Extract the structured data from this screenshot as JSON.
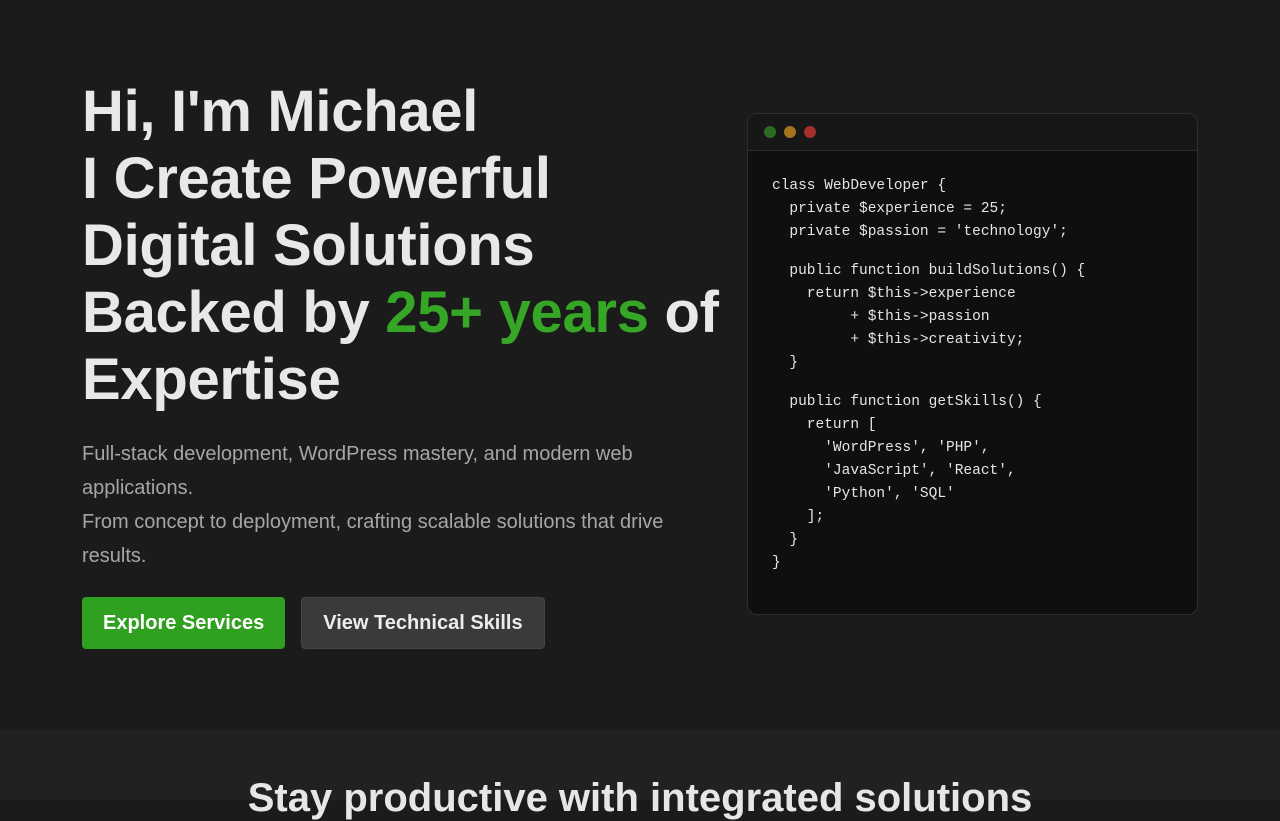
{
  "hero": {
    "line1": "Hi, I'm Michael",
    "line2": "I Create Powerful",
    "line3": "Digital Solutions",
    "line4_pre": "Backed by ",
    "line4_accent": "25+ years",
    "line4_post": " of",
    "line5": "Expertise",
    "accent_color": "#35a626",
    "sub1": "Full-stack development, WordPress mastery, and modern web applications.",
    "sub2": "From concept to deployment, crafting scalable solutions that drive results.",
    "primary_cta": "Explore Services",
    "secondary_cta": "View Technical Skills"
  },
  "code_window": {
    "dots": [
      "green",
      "yellow",
      "red"
    ],
    "lines": [
      "class WebDeveloper {",
      "  private $experience = 25;",
      "  private $passion = 'technology';",
      "",
      "  public function buildSolutions() {",
      "    return $this->experience",
      "         + $this->passion",
      "         + $this->creativity;",
      "  }",
      "",
      "  public function getSkills() {",
      "    return [",
      "      'WordPress', 'PHP',",
      "      'JavaScript', 'React',",
      "      'Python', 'SQL'",
      "    ];",
      "  }",
      "}"
    ]
  },
  "section2": {
    "title": "Stay productive with integrated solutions"
  }
}
